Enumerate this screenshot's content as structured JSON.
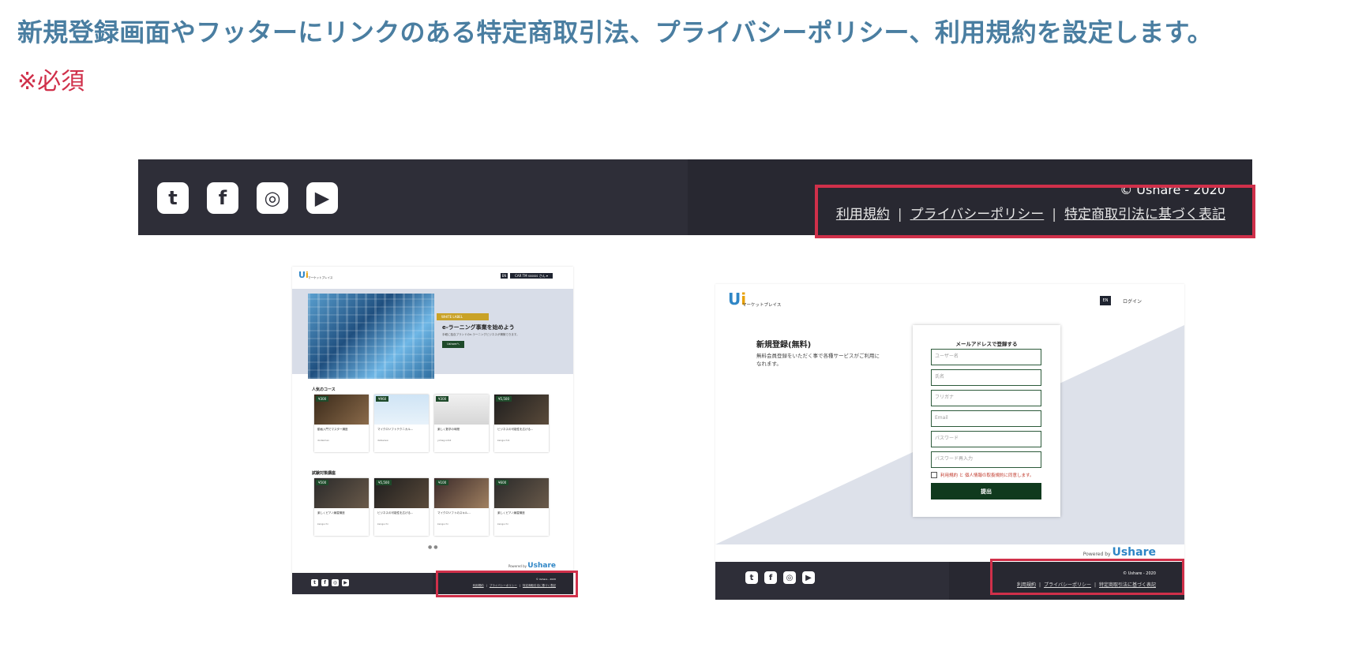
{
  "heading": "新規登録画面やフッターにリンクのある特定商取引法、プライバシーポリシー、利用規約を設定します。",
  "required_note": "※必須",
  "colors": {
    "heading": "#4a7ea1",
    "required": "#d0304a",
    "highlight": "#d0304a",
    "footer_bg": "#2e2e38",
    "accent_green": "#103a1e"
  },
  "social_icons": [
    "twitter-icon",
    "facebook-icon",
    "instagram-icon",
    "youtube-icon"
  ],
  "footer": {
    "copyright": "© Ushare - 2020",
    "links": {
      "terms": "利用規約",
      "privacy": "プライバシーポリシー",
      "commerce": "特定商取引法に基づく表記"
    },
    "separator": "|"
  },
  "top_page": {
    "logo_sub": "マーケットプレイス",
    "lang": "EN",
    "user_menu": "CAR TM ssssss さん ▾",
    "hero": {
      "badge": "WHITE LABEL",
      "title": "e-ラーニング事業を始めよう",
      "subtitle": "手軽に独自ブランドのe-ラーニングビジネスが構築できます。",
      "button": "Ushareへ"
    },
    "sections": [
      {
        "title": "人気のコース",
        "courses": [
          {
            "price": "¥300",
            "title": "動画入門でマスター講座",
            "author": "dodaiman"
          },
          {
            "price": "¥960",
            "title": "マイクロソフトテクニカル...",
            "author": "dataview"
          },
          {
            "price": "¥300",
            "title": "楽しく数学の時間",
            "author": "yohag-ishi2"
          },
          {
            "price": "¥5,500",
            "title": "ビジネスの可能性を広げる...",
            "author": "kenguchi1"
          }
        ]
      },
      {
        "title": "試験対策講座",
        "courses": [
          {
            "price": "¥500",
            "title": "楽しくピアノ練習講座",
            "author": "kenguchi"
          },
          {
            "price": "¥5,500",
            "title": "ビジネスの可能性を広げる...",
            "author": "kenguchi"
          },
          {
            "price": "¥100",
            "title": "マイクロソフトのスキル...",
            "author": "kenguchi"
          },
          {
            "price": "¥600",
            "title": "楽しくピアノ練習講座",
            "author": "kenguchi"
          }
        ]
      }
    ],
    "powered_by": "Powered by",
    "brand": "Ushare"
  },
  "register_page": {
    "logo_sub": "マーケットプレイス",
    "lang": "EN",
    "login": "ログイン",
    "title": "新規登録(無料)",
    "description": "無料会員登録をいただく事で各種サービスがご利用になれます。",
    "form_title": "メールアドレスで登録する",
    "fields": [
      "ユーザー名",
      "氏名",
      "フリガナ",
      "Email",
      "パスワード",
      "パスワード再入力"
    ],
    "agree": "利用規約 と 個人情報の取扱規約に同意します。",
    "submit": "提出",
    "powered_by": "Powered by",
    "brand": "Ushare"
  }
}
